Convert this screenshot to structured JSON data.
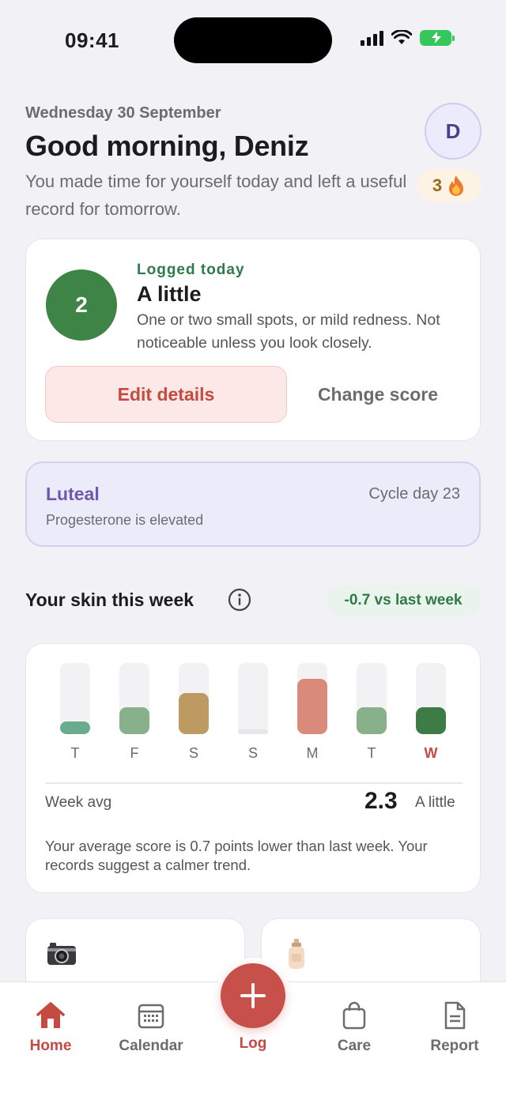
{
  "status": {
    "time": "09:41"
  },
  "header": {
    "date": "Wednesday 30 September",
    "greeting": "Good morning, Deniz",
    "subtitle": "You made time for yourself today and left a useful record for tomorrow.",
    "avatar_initial": "D",
    "streak_count": "3",
    "streak_icon": "fire-icon"
  },
  "today": {
    "label": "Logged today",
    "score": "2",
    "score_name": "A little",
    "description": "One or two small spots, or mild redness. Not noticeable unless you look closely.",
    "edit_label": "Edit details",
    "change_label": "Change score",
    "score_color": "#3e8446"
  },
  "cycle": {
    "phase": "Luteal",
    "day": "Cycle day 23",
    "note": "Progesterone is elevated"
  },
  "week": {
    "title": "Your skin this week",
    "trend": "-0.7 vs last week",
    "avg_label": "Week avg",
    "avg_value": "2.3",
    "avg_name": "A little",
    "note": "Your average score is 0.7 points lower than last week. Your records suggest a calmer trend.",
    "days": [
      {
        "label": "T",
        "level": 0.18,
        "color": "#6aaa8e"
      },
      {
        "label": "F",
        "level": 0.38,
        "color": "#88b08a"
      },
      {
        "label": "S",
        "level": 0.58,
        "color": "#bc9a62"
      },
      {
        "label": "S",
        "level": 0.06,
        "color": "#e6e6ea"
      },
      {
        "label": "M",
        "level": 0.78,
        "color": "#d98a7a"
      },
      {
        "label": "T",
        "level": 0.38,
        "color": "#88b08a"
      },
      {
        "label": "W",
        "level": 0.38,
        "color": "#3e7c47",
        "today": true
      }
    ]
  },
  "peek": {
    "left_icon": "camera-icon",
    "right_icon": "lotion-bottle-icon"
  },
  "tabs": {
    "home": "Home",
    "calendar": "Calendar",
    "log": "Log",
    "care": "Care",
    "report": "Report"
  }
}
